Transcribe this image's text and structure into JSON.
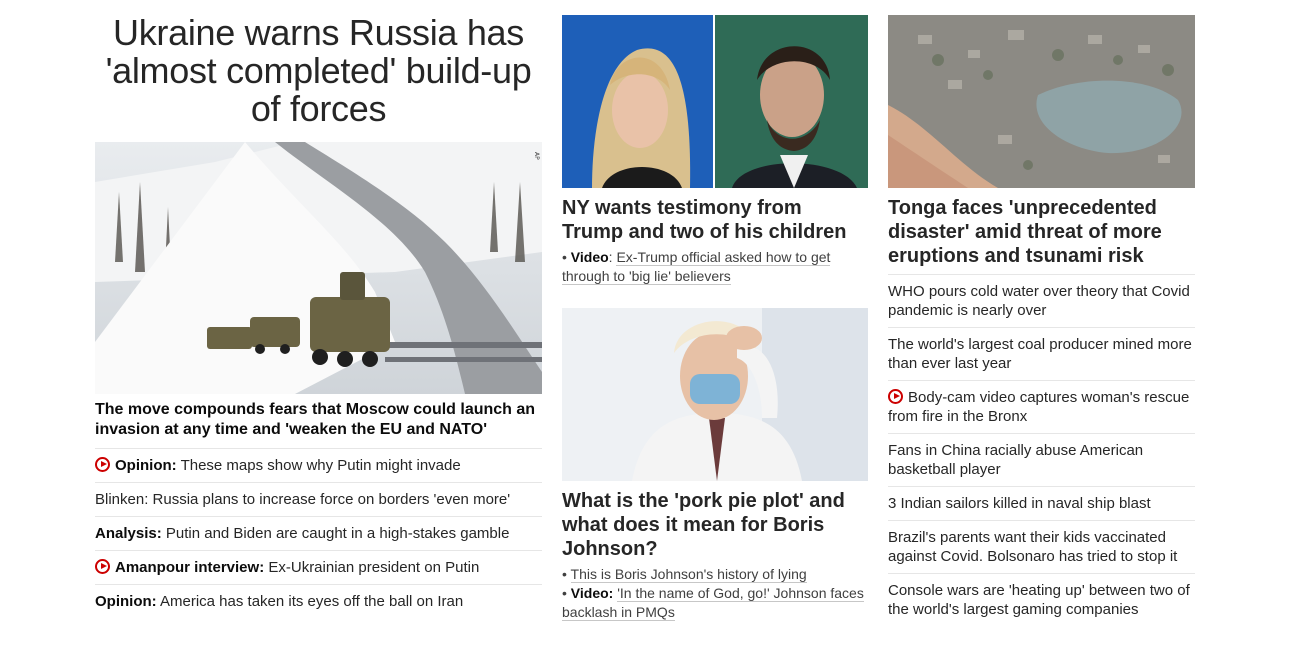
{
  "lead": {
    "headline": "Ukraine warns Russia has 'almost completed' build-up of forces",
    "image_credit": "AP",
    "sub": "The move compounds fears that Moscow could launch an invasion at any time and 'weaken the EU and NATO'",
    "related": [
      {
        "icon": "play-icon",
        "prefix": "Opinion:",
        "text": "These maps show why Putin might invade"
      },
      {
        "icon": "",
        "prefix": "",
        "text": "Blinken: Russia plans to increase force on borders 'even more'"
      },
      {
        "icon": "",
        "prefix": "Analysis:",
        "text": "Putin and Biden are caught in a high-stakes gamble"
      },
      {
        "icon": "play-icon",
        "prefix": "Amanpour interview:",
        "text": "Ex-Ukrainian president on Putin"
      },
      {
        "icon": "",
        "prefix": "Opinion:",
        "text": "America has taken its eyes off the ball on Iran"
      }
    ]
  },
  "story2": {
    "headline": "NY wants testimony from Trump and two of his children",
    "link_prefix": "Video",
    "link_text": "Ex-Trump official asked how to get through to 'big lie' believers"
  },
  "story3": {
    "headline": "What is the 'pork pie plot' and what does it mean for Boris Johnson?",
    "link1": "This is Boris Johnson's history of lying",
    "link2_prefix": "Video:",
    "link2_text": "'In the name of God, go!' Johnson faces backlash in PMQs"
  },
  "story4": {
    "headline": "Tonga faces 'unprecedented disaster' amid threat of more eruptions and tsunami risk",
    "list": [
      {
        "icon": "",
        "text": "WHO pours cold water over theory that Covid pandemic is nearly over"
      },
      {
        "icon": "",
        "text": "The world's largest coal producer mined more than ever last year"
      },
      {
        "icon": "play-icon",
        "text": "Body-cam video captures woman's rescue from fire in the Bronx"
      },
      {
        "icon": "",
        "text": "Fans in China racially abuse American basketball player"
      },
      {
        "icon": "",
        "text": "3 Indian sailors killed in naval ship blast"
      },
      {
        "icon": "",
        "text": "Brazil's parents want their kids vaccinated against Covid. Bolsonaro has tried to stop it"
      },
      {
        "icon": "",
        "text": "Console wars are 'heating up' between two of the world's largest gaming companies"
      }
    ]
  },
  "colors": {
    "play_red": "#cc0000",
    "text": "#262626",
    "divider": "#e6e6e6"
  }
}
